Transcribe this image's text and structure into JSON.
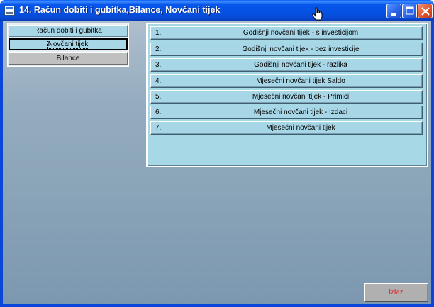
{
  "window": {
    "title": "14. Račun dobiti i gubitka,Bilance, Novčani tijek",
    "icon": "window-app-icon",
    "controls": [
      "minimize-icon",
      "maximize-icon",
      "close-icon"
    ]
  },
  "left_menu": {
    "items": [
      {
        "label": "Račun dobiti i gubitka"
      },
      {
        "label": "Novčani tijek",
        "selected": true
      },
      {
        "label": "Bilance"
      }
    ]
  },
  "cash_flow_list": {
    "rows": [
      {
        "num": "1.",
        "label": "Godišnji novčani tijek - s investicijom"
      },
      {
        "num": "2.",
        "label": "Godišnji novčani tijek - bez investicije"
      },
      {
        "num": "3.",
        "label": "Godišnji novčani tijek - razlika"
      },
      {
        "num": "4.",
        "label": "Mjesečni novčani tijek Saldo"
      },
      {
        "num": "5.",
        "label": "Mjesečni novčani tijek -  Primici"
      },
      {
        "num": "6.",
        "label": "Mjesečni novčani tijek - Izdaci"
      },
      {
        "num": "7.",
        "label": "Mjesečni novčani tijek"
      }
    ]
  },
  "footer": {
    "exit_label": "Izlaz"
  },
  "colors": {
    "title_bar": "#0451e2",
    "panel_bg": "#a6d8e6",
    "exit_text": "#e8191a"
  }
}
